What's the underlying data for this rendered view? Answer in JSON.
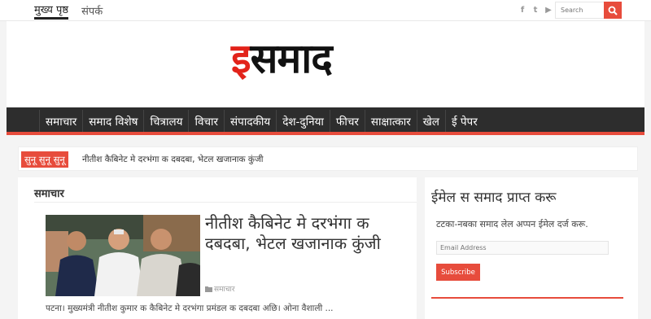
{
  "topnav": {
    "home": "मुख्य पृष्ठ",
    "contact": "संपर्क"
  },
  "social": {
    "facebook": "f",
    "twitter": "t",
    "youtube": "▶"
  },
  "search": {
    "placeholder": "Search"
  },
  "logo": {
    "accent": "इ",
    "rest": "समाद",
    "accent_color": "#e2231a"
  },
  "mainnav": {
    "items": [
      "समाचार",
      "समाद विशेष",
      "चित्रालय",
      "विचार",
      "संपादकीय",
      "देश-दुनिया",
      "फीचर",
      "साक्षात्कार",
      "खेल",
      "ई पेपर"
    ]
  },
  "breaking": {
    "label": "सुनू सुनू सुनू",
    "text": "नीतीश कैबिनेट मे दरभंगा क दबदबा, भेटल खजानाक कुंजी"
  },
  "main": {
    "section_title": "समाचार",
    "post": {
      "title": "नीतीश कैबिनेट मे दरभंगा क दबदबा, भेटल खजानाक कुंजी",
      "category": "समाचार",
      "excerpt": "पटना। मुख्यमंत्री नीतीश कुमार क कैबिनेट मे दरभंगा प्रमंडल क दबदबा अछि। ओना वैशाली ..."
    }
  },
  "sidebar": {
    "widget_title": "ईमेल स समाद प्राप्त करू",
    "widget_text": "टटका-नबका समाद लेल अप्पन ईमेल दर्ज करू.",
    "email_placeholder": "Email Address",
    "subscribe_label": "Subscribe"
  },
  "colors": {
    "accent": "#e74c3c",
    "nav_bg": "#2d2d2d"
  }
}
